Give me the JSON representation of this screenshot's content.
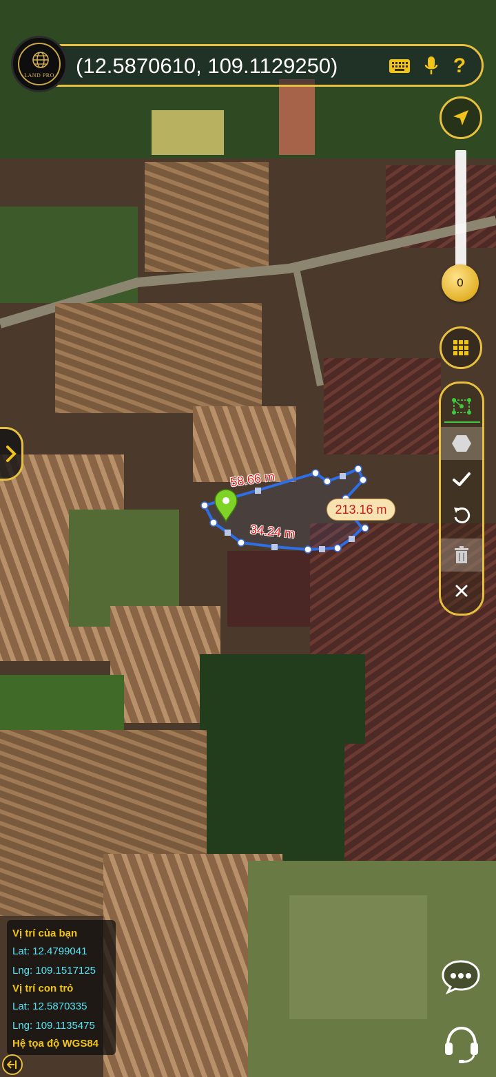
{
  "app": {
    "logo_text": "LAND PRO"
  },
  "search": {
    "coordinates": "(12.5870610, 109.1129250)",
    "icons": [
      "keyboard-icon",
      "microphone-icon",
      "help-icon"
    ]
  },
  "controls": {
    "zoom_value": "0",
    "icons": [
      "locate-arrow-icon",
      "grid-icon",
      "polygon-tool-icon",
      "hexagon-icon",
      "check-icon",
      "undo-icon",
      "trash-icon",
      "close-icon"
    ]
  },
  "measurement": {
    "segment_top": "58.66 m",
    "segment_bottom": "34.24 m",
    "total": "213.16 m"
  },
  "info_panel": {
    "your_location_label": "Vị trí của bạn",
    "your_lat": "Lat: 12.4799041",
    "your_lng": "Lng: 109.1517125",
    "pointer_label": "Vị trí con trỏ",
    "pointer_lat": "Lat: 12.5870335",
    "pointer_lng": "Lng: 109.1135475",
    "datum": "Hệ tọa độ WGS84"
  },
  "colors": {
    "accent": "#e8c040",
    "path": "#2f6fe6",
    "label_red": "#e41b1b",
    "info_cyan": "#59e3f3"
  }
}
